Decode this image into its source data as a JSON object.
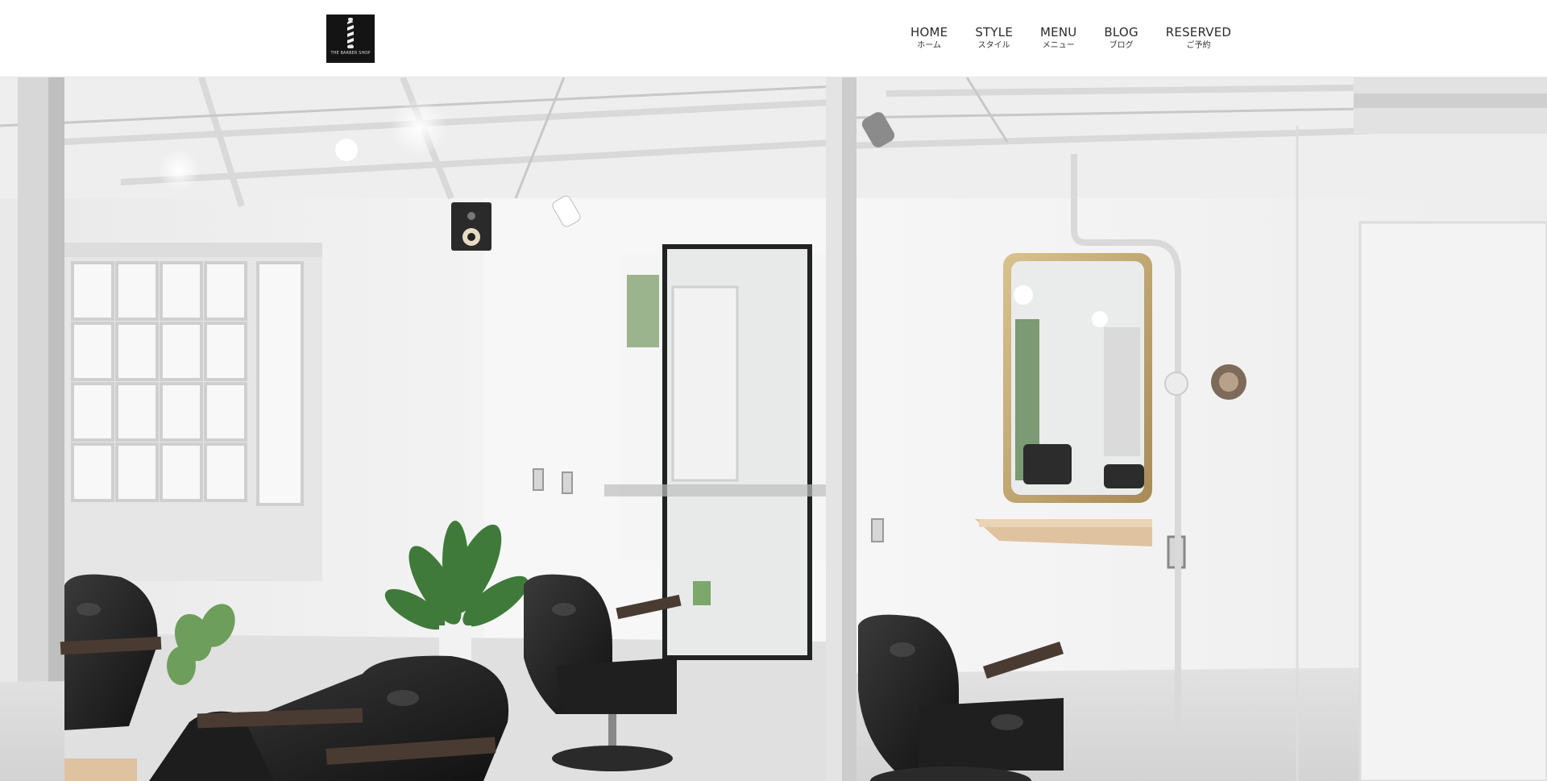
{
  "logo": {
    "text": "THE BARBER SHOP",
    "icon": "barber-pole-icon",
    "background": "#141414"
  },
  "nav": {
    "items": [
      {
        "en": "HOME",
        "ja": "ホーム"
      },
      {
        "en": "STYLE",
        "ja": "スタイル"
      },
      {
        "en": "MENU",
        "ja": "メニュー"
      },
      {
        "en": "BLOG",
        "ja": "ブログ"
      },
      {
        "en": "RESERVED",
        "ja": "ご予約"
      }
    ]
  },
  "hero": {
    "image": "barbershop-interior-photo"
  },
  "colors": {
    "header_bg": "#ffffff",
    "nav_text": "#2b2b2b",
    "logo_bg": "#141414"
  }
}
